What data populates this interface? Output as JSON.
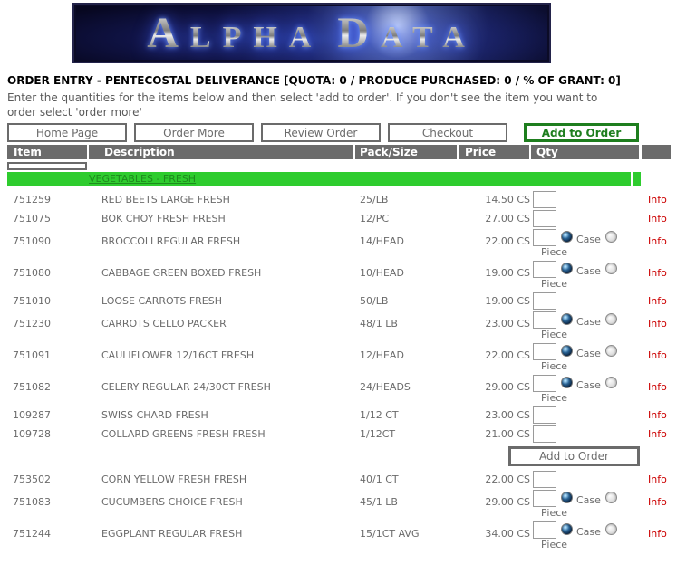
{
  "banner": {
    "word1_initial": "A",
    "word1_rest": "LPHA",
    "word2_initial": "D",
    "word2_rest": "ATA"
  },
  "page": {
    "title": "ORDER ENTRY - PENTECOSTAL DELIVERANCE [QUOTA: 0 / PRODUCE PURCHASED: 0 / % OF GRANT: 0]",
    "instructions_line1": "Enter the quantities for the items below and then select 'add to order'. If you don't see the item you want to",
    "instructions_line2": "order select 'order more'"
  },
  "nav": {
    "home": "Home Page",
    "order_more": "Order More",
    "review_order": "Review Order",
    "checkout": "Checkout",
    "add_to_order": "Add to Order"
  },
  "table": {
    "headers": {
      "item": "Item",
      "description": "Description",
      "pack": "Pack/Size",
      "price": "Price",
      "qty": "Qty"
    },
    "category_label": "VEGETABLES - FRESH",
    "unit_case_label": "Case",
    "unit_piece_label": "Piece",
    "info_label": "Info",
    "mid_button": {
      "label": "Add to Order",
      "after_item": "109728"
    },
    "rows": [
      {
        "item": "751259",
        "description": "RED BEETS LARGE FRESH",
        "pack": "25/LB",
        "price": "14.50 CS",
        "qty_value": "",
        "has_unit_choice": false
      },
      {
        "item": "751075",
        "description": "BOK CHOY FRESH FRESH",
        "pack": "12/PC",
        "price": "27.00 CS",
        "qty_value": "",
        "has_unit_choice": false
      },
      {
        "item": "751090",
        "description": "BROCCOLI REGULAR FRESH",
        "pack": "14/HEAD",
        "price": "22.00 CS",
        "qty_value": "",
        "has_unit_choice": true,
        "unit_selected": "Case"
      },
      {
        "item": "751080",
        "description": "CABBAGE GREEN BOXED FRESH",
        "pack": "10/HEAD",
        "price": "19.00 CS",
        "qty_value": "",
        "has_unit_choice": true,
        "unit_selected": "Case"
      },
      {
        "item": "751010",
        "description": "LOOSE CARROTS FRESH",
        "pack": "50/LB",
        "price": "19.00 CS",
        "qty_value": "",
        "has_unit_choice": false
      },
      {
        "item": "751230",
        "description": "CARROTS CELLO PACKER",
        "pack": "48/1 LB",
        "price": "23.00 CS",
        "qty_value": "",
        "has_unit_choice": true,
        "unit_selected": "Case"
      },
      {
        "item": "751091",
        "description": "CAULIFLOWER 12/16CT FRESH",
        "pack": "12/HEAD",
        "price": "22.00 CS",
        "qty_value": "",
        "has_unit_choice": true,
        "unit_selected": "Case"
      },
      {
        "item": "751082",
        "description": "CELERY REGULAR 24/30CT FRESH",
        "pack": "24/HEADS",
        "price": "29.00 CS",
        "qty_value": "",
        "has_unit_choice": true,
        "unit_selected": "Case"
      },
      {
        "item": "109287",
        "description": "SWISS CHARD FRESH",
        "pack": "1/12 CT",
        "price": "23.00 CS",
        "qty_value": "",
        "has_unit_choice": false
      },
      {
        "item": "109728",
        "description": "COLLARD GREENS FRESH FRESH",
        "pack": "1/12CT",
        "price": "21.00 CS",
        "qty_value": "",
        "has_unit_choice": false
      },
      {
        "item": "753502",
        "description": "CORN YELLOW FRESH FRESH",
        "pack": "40/1 CT",
        "price": "22.00 CS",
        "qty_value": "",
        "has_unit_choice": false
      },
      {
        "item": "751083",
        "description": "CUCUMBERS CHOICE FRESH",
        "pack": "45/1 LB",
        "price": "29.00 CS",
        "qty_value": "",
        "has_unit_choice": true,
        "unit_selected": "Case"
      },
      {
        "item": "751244",
        "description": "EGGPLANT REGULAR FRESH",
        "pack": "15/1CT AVG",
        "price": "34.00 CS",
        "qty_value": "",
        "has_unit_choice": true,
        "unit_selected": "Case"
      }
    ]
  },
  "colors": {
    "header_bg": "#6b6b6b",
    "category_bg": "#2ecc2e",
    "category_text": "#1d8a1d",
    "accent_green": "#1e7e1e",
    "info_red": "#cc0000",
    "body_text_gray": "#6b6b6b"
  }
}
